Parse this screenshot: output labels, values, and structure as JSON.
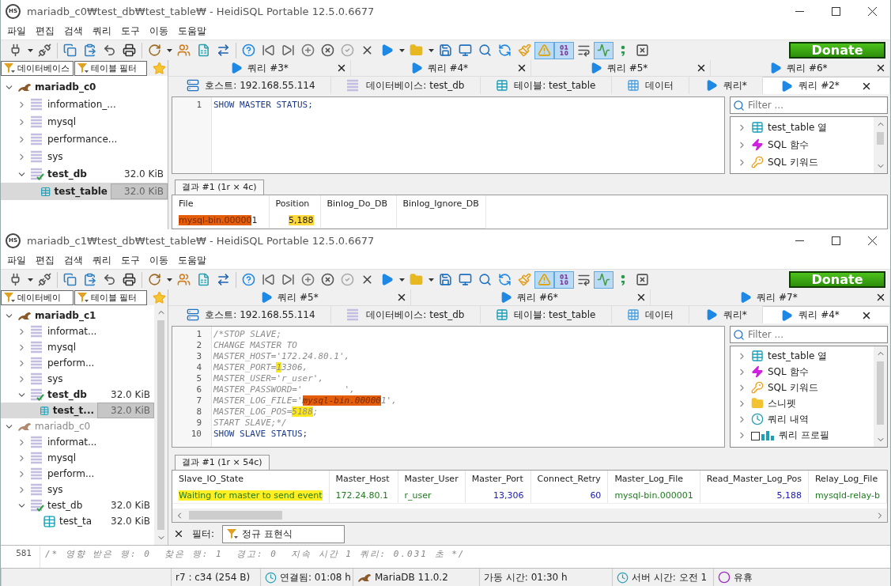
{
  "windows": [
    {
      "logo": "HS",
      "title": "mariadb_c0₩test_db₩test_table₩ - HeidiSQL Portable 12.5.0.6677",
      "menu": [
        "파일",
        "편집",
        "검색",
        "쿼리",
        "도구",
        "이동",
        "도움말"
      ],
      "toolbar": [
        {
          "kind": "connect",
          "pressed": false
        },
        {
          "kind": "caret",
          "pressed": false
        },
        {
          "kind": "disconnect",
          "pressed": false
        },
        {
          "kind": "separator"
        },
        {
          "kind": "copy",
          "pressed": false
        },
        {
          "kind": "paste",
          "pressed": false
        },
        {
          "kind": "undo",
          "pressed": false
        },
        {
          "kind": "print",
          "pressed": false
        },
        {
          "kind": "separator"
        },
        {
          "kind": "refresh",
          "pressed": false
        },
        {
          "kind": "caret",
          "pressed": false
        },
        {
          "kind": "users",
          "pressed": false
        },
        {
          "kind": "export",
          "pressed": false
        },
        {
          "kind": "arrows",
          "pressed": false
        },
        {
          "kind": "separator"
        },
        {
          "kind": "help",
          "pressed": false
        },
        {
          "kind": "first",
          "pressed": false
        },
        {
          "kind": "last",
          "pressed": false
        },
        {
          "kind": "add",
          "pressed": false
        },
        {
          "kind": "cancel",
          "pressed": false
        },
        {
          "kind": "apply",
          "pressed": false
        },
        {
          "kind": "delete",
          "pressed": false
        },
        {
          "kind": "run",
          "pressed": false
        },
        {
          "kind": "caret",
          "pressed": false
        },
        {
          "kind": "open",
          "pressed": false
        },
        {
          "kind": "caret",
          "pressed": false
        },
        {
          "kind": "save",
          "pressed": false
        },
        {
          "kind": "monitor",
          "pressed": false
        },
        {
          "kind": "find",
          "pressed": false
        },
        {
          "kind": "replace",
          "pressed": false
        },
        {
          "kind": "clean",
          "pressed": false
        },
        {
          "kind": "warn",
          "pressed": true
        },
        {
          "kind": "binary",
          "pressed": true
        },
        {
          "kind": "wrap",
          "pressed": false
        },
        {
          "kind": "wave",
          "pressed": true
        },
        {
          "kind": "semicolon",
          "pressed": false
        },
        {
          "kind": "close",
          "pressed": false
        }
      ],
      "donate": "Donate",
      "sidebar": {
        "filters": [
          "데이터베이스",
          "테이블 필터"
        ],
        "scrollbar": false,
        "tree": [
          {
            "kind": "server",
            "label": "mariadb_c0",
            "active": true,
            "expanded": true,
            "selected": false,
            "children": [
              {
                "kind": "database",
                "label": "information_...",
                "expanded": false,
                "checked": false,
                "selected": false
              },
              {
                "kind": "database",
                "label": "mysql",
                "expanded": false,
                "checked": false,
                "selected": false
              },
              {
                "kind": "database",
                "label": "performance...",
                "expanded": false,
                "checked": false,
                "selected": false
              },
              {
                "kind": "database",
                "label": "sys",
                "expanded": false,
                "checked": false,
                "selected": false
              },
              {
                "kind": "database",
                "label": "test_db",
                "size": "32.0 KiB",
                "expanded": true,
                "checked": true,
                "selected": false,
                "children": [
                  {
                    "kind": "table",
                    "label": "test_table",
                    "size": "32.0 KiB",
                    "selected": true
                  }
                ]
              }
            ]
          }
        ]
      },
      "query_tabs": [
        "쿼리 #3*",
        "쿼리 #4*",
        "쿼리 #5*",
        "쿼리 #6*"
      ],
      "tabs": [
        {
          "kind": "host",
          "label": "호스트: 192.168.55.114",
          "selected": false
        },
        {
          "kind": "database",
          "label": "데이터베이스: test_db",
          "selected": false
        },
        {
          "kind": "table",
          "label": "테이블: test_table",
          "selected": false
        },
        {
          "kind": "data",
          "label": "데이터",
          "selected": false
        },
        {
          "kind": "query",
          "label": "쿼리*",
          "selected": false
        },
        {
          "kind": "query",
          "label": "쿼리 #2*",
          "selected": true
        }
      ],
      "editor": [
        {
          "number": "1",
          "kind": "keyword",
          "segments": [
            {
              "text": "SHOW MASTER STATUS;"
            }
          ]
        }
      ],
      "helper": {
        "placeholder": "Filter ...",
        "items": [
          {
            "kind": "columns",
            "label": "test_table 열"
          },
          {
            "kind": "functions",
            "label": "SQL 함수"
          },
          {
            "kind": "keywords",
            "label": "SQL 키워드"
          }
        ]
      },
      "result": {
        "tab": "결과 #1 (1r × 4c)",
        "colored": false,
        "columns": [
          {
            "label": "File",
            "kind": "text"
          },
          {
            "label": "Position",
            "kind": "number"
          },
          {
            "label": "Binlog_Do_DB",
            "kind": "text"
          },
          {
            "label": "Binlog_Ignore_DB",
            "kind": "text"
          }
        ],
        "rows": [
          [
            [
              {
                "text": "mysql-bin.00000",
                "color": "#e35d0a"
              },
              {
                "text": "1"
              }
            ],
            [
              {
                "text": "5,188",
                "color": "#ffd93a"
              }
            ],
            [],
            []
          ]
        ]
      }
    },
    {
      "logo": "HS",
      "title": "mariadb_c1₩test_db₩test_table₩ - HeidiSQL Portable 12.5.0.6677",
      "menu": [
        "파일",
        "편집",
        "검색",
        "쿼리",
        "도구",
        "이동",
        "도움말"
      ],
      "toolbar": [
        {
          "kind": "connect",
          "pressed": false
        },
        {
          "kind": "caret",
          "pressed": false
        },
        {
          "kind": "disconnect",
          "pressed": false
        },
        {
          "kind": "separator"
        },
        {
          "kind": "copy",
          "pressed": false
        },
        {
          "kind": "paste",
          "pressed": false
        },
        {
          "kind": "undo",
          "pressed": false
        },
        {
          "kind": "print",
          "pressed": false
        },
        {
          "kind": "separator"
        },
        {
          "kind": "refresh",
          "pressed": false
        },
        {
          "kind": "caret",
          "pressed": false
        },
        {
          "kind": "users",
          "pressed": false
        },
        {
          "kind": "export",
          "pressed": false
        },
        {
          "kind": "arrows",
          "pressed": false
        },
        {
          "kind": "separator"
        },
        {
          "kind": "help",
          "pressed": false
        },
        {
          "kind": "first",
          "pressed": false
        },
        {
          "kind": "last",
          "pressed": false
        },
        {
          "kind": "add",
          "pressed": false
        },
        {
          "kind": "cancel",
          "pressed": false
        },
        {
          "kind": "apply",
          "pressed": false
        },
        {
          "kind": "delete",
          "pressed": false
        },
        {
          "kind": "run",
          "pressed": false
        },
        {
          "kind": "caret",
          "pressed": false
        },
        {
          "kind": "open",
          "pressed": false
        },
        {
          "kind": "caret",
          "pressed": false
        },
        {
          "kind": "save",
          "pressed": false
        },
        {
          "kind": "monitor",
          "pressed": false
        },
        {
          "kind": "find",
          "pressed": false
        },
        {
          "kind": "replace",
          "pressed": false
        },
        {
          "kind": "clean",
          "pressed": false
        },
        {
          "kind": "warn",
          "pressed": true
        },
        {
          "kind": "binary",
          "pressed": true
        },
        {
          "kind": "wrap",
          "pressed": false
        },
        {
          "kind": "wave",
          "pressed": true
        },
        {
          "kind": "semicolon",
          "pressed": false
        },
        {
          "kind": "close",
          "pressed": false
        }
      ],
      "donate": "Donate",
      "sidebar": {
        "filters": [
          "데이터베이",
          "테이블 필터"
        ],
        "scrollbar": true,
        "tree": [
          {
            "kind": "server",
            "label": "mariadb_c1",
            "active": true,
            "expanded": true,
            "selected": false,
            "children": [
              {
                "kind": "database",
                "label": "informat...",
                "expanded": false,
                "checked": false,
                "selected": false
              },
              {
                "kind": "database",
                "label": "mysql",
                "expanded": false,
                "checked": false,
                "selected": false
              },
              {
                "kind": "database",
                "label": "perform...",
                "expanded": false,
                "checked": false,
                "selected": false
              },
              {
                "kind": "database",
                "label": "sys",
                "expanded": false,
                "checked": false,
                "selected": false
              },
              {
                "kind": "database",
                "label": "test_db",
                "size": "32.0 KiB",
                "expanded": true,
                "checked": true,
                "selected": false,
                "children": [
                  {
                    "kind": "table",
                    "label": "test_t...",
                    "size": "32.0 KiB",
                    "selected": true
                  }
                ]
              }
            ]
          },
          {
            "kind": "server",
            "label": "mariadb_c0",
            "active": false,
            "expanded": true,
            "selected": false,
            "children": [
              {
                "kind": "database",
                "label": "informat...",
                "expanded": false,
                "checked": false,
                "selected": false
              },
              {
                "kind": "database",
                "label": "mysql",
                "expanded": false,
                "checked": false,
                "selected": false
              },
              {
                "kind": "database",
                "label": "perform...",
                "expanded": false,
                "checked": false,
                "selected": false
              },
              {
                "kind": "database",
                "label": "sys",
                "expanded": false,
                "checked": false,
                "selected": false
              },
              {
                "kind": "database",
                "label": "test_db",
                "size": "32.0 KiB",
                "expanded": true,
                "checked": true,
                "selected": false,
                "children": [
                  {
                    "kind": "table",
                    "label": "test_ta",
                    "size": "32.0 KiB",
                    "selected": false
                  }
                ]
              }
            ]
          }
        ]
      },
      "query_tabs": [
        "쿼리 #5*",
        "쿼리 #6*",
        "쿼리 #7*"
      ],
      "tabs": [
        {
          "kind": "host",
          "label": "호스트: 192.168.55.114",
          "selected": false
        },
        {
          "kind": "database",
          "label": "데이터베이스: test_db",
          "selected": false
        },
        {
          "kind": "table",
          "label": "테이블: test_table",
          "selected": false
        },
        {
          "kind": "data",
          "label": "데이터",
          "selected": false
        },
        {
          "kind": "query",
          "label": "쿼리*",
          "selected": false
        },
        {
          "kind": "query",
          "label": "쿼리 #4*",
          "selected": true
        }
      ],
      "editor": [
        {
          "number": "1",
          "kind": "comment",
          "segments": [
            {
              "text": "/*STOP SLAVE;"
            }
          ]
        },
        {
          "number": "2",
          "kind": "comment",
          "segments": [
            {
              "text": "CHANGE MASTER TO"
            }
          ]
        },
        {
          "number": "3",
          "kind": "comment",
          "segments": [
            {
              "text": "MASTER_HOST='172.24.80.1',"
            }
          ]
        },
        {
          "number": "4",
          "kind": "comment",
          "segments": [
            {
              "text": "MASTER_PORT="
            },
            {
              "text": "1",
              "color": "#ffe81a"
            },
            {
              "text": "3306,"
            }
          ]
        },
        {
          "number": "5",
          "kind": "comment",
          "segments": [
            {
              "text": "MASTER_USER='r_user',"
            }
          ]
        },
        {
          "number": "6",
          "kind": "comment",
          "segments": [
            {
              "text": "MASTER_PASSWORD='        ',"
            }
          ]
        },
        {
          "number": "7",
          "kind": "comment",
          "segments": [
            {
              "text": "MASTER_LOG_FILE='"
            },
            {
              "text": "mysql-bin.00000",
              "color": "#e35d0a"
            },
            {
              "text": "1',"
            }
          ]
        },
        {
          "number": "8",
          "kind": "comment",
          "segments": [
            {
              "text": "MASTER_LOG_POS="
            },
            {
              "text": "5188",
              "color": "#ffe81a"
            },
            {
              "text": ";"
            }
          ]
        },
        {
          "number": "9",
          "kind": "comment",
          "segments": [
            {
              "text": "START SLAVE;*/"
            }
          ]
        },
        {
          "number": "10",
          "kind": "keyword",
          "segments": [
            {
              "text": "SHOW SLAVE STATUS;"
            }
          ]
        }
      ],
      "helper": {
        "placeholder": "Filter ...",
        "items": [
          {
            "kind": "columns",
            "label": "test_table 열"
          },
          {
            "kind": "functions",
            "label": "SQL 함수"
          },
          {
            "kind": "keywords",
            "label": "SQL 키워드"
          },
          {
            "kind": "snippets",
            "label": "스니펫"
          },
          {
            "kind": "history",
            "label": "쿼리 내역"
          },
          {
            "kind": "profile",
            "label": "쿼리 프로필"
          }
        ]
      },
      "result": {
        "tab": "결과 #1 (1r × 54c)",
        "colored": true,
        "columns": [
          {
            "label": "Slave_IO_State",
            "kind": "text"
          },
          {
            "label": "Master_Host",
            "kind": "text"
          },
          {
            "label": "Master_User",
            "kind": "text"
          },
          {
            "label": "Master_Port",
            "kind": "number"
          },
          {
            "label": "Connect_Retry",
            "kind": "number"
          },
          {
            "label": "Master_Log_File",
            "kind": "text"
          },
          {
            "label": "Read_Master_Log_Pos",
            "kind": "number"
          },
          {
            "label": "Relay_Log_File",
            "kind": "text"
          }
        ],
        "rows": [
          [
            [
              {
                "text": "Waiting for master to send event",
                "color": "#ffee22"
              }
            ],
            [
              {
                "text": "172.24.80.1"
              }
            ],
            [
              {
                "text": "r_user"
              }
            ],
            [
              {
                "text": "13,306"
              }
            ],
            [
              {
                "text": "60"
              }
            ],
            [
              {
                "text": "mysql-bin.000001"
              }
            ],
            [
              {
                "text": "5,188"
              }
            ],
            [
              {
                "text": "mysqld-relay-b"
              }
            ]
          ]
        ]
      },
      "filter": {
        "label": "필터:",
        "mode": "정규 표현식"
      },
      "log": [
        {
          "number": "581",
          "text": "/* 영향 받은 행: 0  찾은 행: 1  경고: 0  지속 시간 1 쿼리: 0.031 초 */"
        }
      ],
      "status": [
        {
          "kind": "cursor",
          "text": "r7 : c34 (254 B)"
        },
        {
          "kind": "connected",
          "text": "연결됨: 01:08 h"
        },
        {
          "kind": "server",
          "text": "MariaDB 11.0.2"
        },
        {
          "kind": "uptime",
          "text": "가동 시간: 01:30 h"
        },
        {
          "kind": "time",
          "text": "서버 시간: 오전 1"
        },
        {
          "kind": "idle",
          "text": "유휴"
        }
      ]
    }
  ]
}
